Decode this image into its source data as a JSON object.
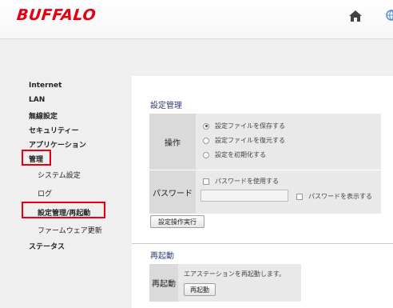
{
  "header": {
    "logo": "BUFFALO"
  },
  "sidebar": {
    "items": [
      {
        "label": "Internet"
      },
      {
        "label": "LAN"
      },
      {
        "label": "無線設定"
      },
      {
        "label": "セキュリティー"
      },
      {
        "label": "アプリケーション"
      },
      {
        "label": "管理"
      },
      {
        "label": "システム設定"
      },
      {
        "label": "ログ"
      },
      {
        "label": "設定管理/再起動"
      },
      {
        "label": "ファームウェア更新"
      },
      {
        "label": "ステータス"
      }
    ]
  },
  "settings": {
    "title": "設定管理",
    "operation_label": "操作",
    "options": [
      "設定ファイルを保存する",
      "設定ファイルを復元する",
      "設定を初期化する"
    ],
    "password_label": "パスワード",
    "use_password": "パスワードを使用する",
    "show_password": "パスワードを表示する",
    "execute_button": "設定操作実行"
  },
  "reboot": {
    "title": "再起動",
    "label": "再起動",
    "message": "エアステーションを再起動します。",
    "button": "再起動"
  },
  "colors": {
    "brand": "#e60012",
    "highlight": "#e60012",
    "section_title": "#2d3e75"
  }
}
